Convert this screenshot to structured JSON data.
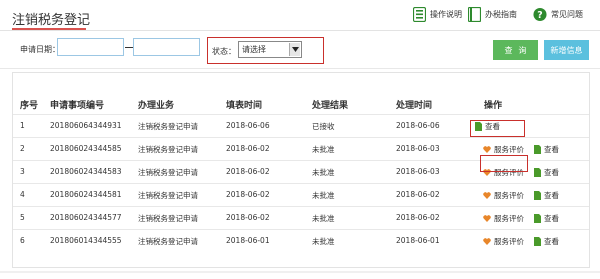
{
  "header": {
    "title": "注销税务登记",
    "links": [
      {
        "label": "操作说明",
        "icon": "list-icon",
        "color": "#5a9f3a"
      },
      {
        "label": "办税指南",
        "icon": "book-icon",
        "color": "#5a9f3a"
      },
      {
        "label": "常见问题",
        "icon": "question-icon",
        "color": "#5a9f3a"
      }
    ]
  },
  "filter": {
    "date_label": "申请日期：",
    "date_from": "",
    "date_to": "",
    "status_label": "状态：",
    "status_value": "请选择",
    "query_button": "查询",
    "new_button": "新增信息"
  },
  "table": {
    "columns": [
      "序号",
      "申请事项编号",
      "办理业务",
      "填表时间",
      "处理结果",
      "处理时间",
      "操作"
    ],
    "rows": [
      {
        "no": "1",
        "id": "201806064344931",
        "business": "注销税务登记申请",
        "fill_date": "2018-06-06",
        "result": "已接收",
        "process_date": "2018-06-06",
        "actions": [
          "查看"
        ]
      },
      {
        "no": "2",
        "id": "201806024344585",
        "business": "注销税务登记申请",
        "fill_date": "2018-06-02",
        "result": "未批准",
        "process_date": "2018-06-03",
        "actions": [
          "服务评价",
          "查看"
        ]
      },
      {
        "no": "3",
        "id": "201806024344583",
        "business": "注销税务登记申请",
        "fill_date": "2018-06-02",
        "result": "未批准",
        "process_date": "2018-06-03",
        "actions": [
          "服务评价",
          "查看"
        ]
      },
      {
        "no": "4",
        "id": "201806024344581",
        "business": "注销税务登记申请",
        "fill_date": "2018-06-02",
        "result": "未批准",
        "process_date": "2018-06-02",
        "actions": [
          "服务评价",
          "查看"
        ]
      },
      {
        "no": "5",
        "id": "201806024344577",
        "business": "注销税务登记申请",
        "fill_date": "2018-06-02",
        "result": "未批准",
        "process_date": "2018-06-02",
        "actions": [
          "服务评价",
          "查看"
        ]
      },
      {
        "no": "6",
        "id": "201806014344555",
        "business": "注销税务登记申请",
        "fill_date": "2018-06-01",
        "result": "未批准",
        "process_date": "2018-06-01",
        "actions": [
          "服务评价",
          "查看"
        ]
      }
    ]
  },
  "colors": {
    "accent_red": "#c9302c",
    "green": "#5cb85c",
    "teal": "#5bc0de",
    "icon_green": "#4a9a2a",
    "heart_orange": "#e8862a"
  }
}
